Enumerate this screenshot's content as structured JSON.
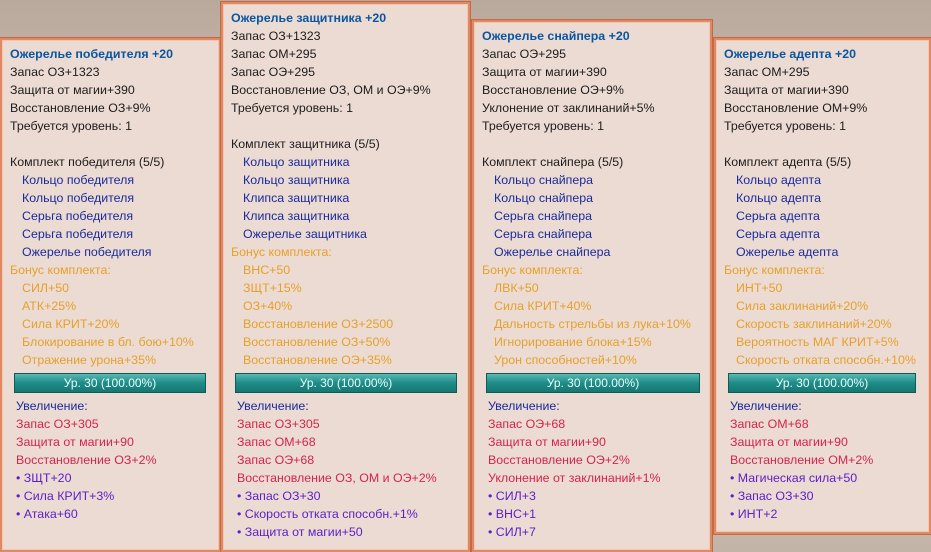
{
  "cards": [
    {
      "title": "Ожерелье победителя +20",
      "stats": [
        "Запас ОЗ+1323",
        "Защита от магии+390",
        "Восстановление ОЗ+9%",
        "Требуется уровень: 1"
      ],
      "set_name": "Комплект победителя (5/5)",
      "set_items": [
        "Кольцо победителя",
        "Кольцо победителя",
        "Серьга победителя",
        "Серьга победителя",
        "Ожерелье победителя"
      ],
      "bonus_header": "Бонус комплекта:",
      "bonuses": [
        "СИЛ+50",
        "АТК+25%",
        "Сила КРИТ+20%",
        "Блокирование в бл. бою+10%",
        "Отражение урона+35%"
      ],
      "level_bar": "Ур. 30 (100.00%)",
      "increase_header": "Увеличение:",
      "increases": [
        "Запас ОЗ+305",
        "Защита от магии+90",
        "Восстановление ОЗ+2%"
      ],
      "extras": [
        "• ЗЩТ+20",
        "• Сила КРИТ+3%",
        "• Атака+60"
      ]
    },
    {
      "title": "Ожерелье защитника +20",
      "stats": [
        "Запас ОЗ+1323",
        "Запас ОМ+295",
        "Запас ОЭ+295",
        "Восстановление ОЗ, ОМ и ОЭ+9%",
        "Требуется уровень: 1"
      ],
      "set_name": "Комплект защитника (5/5)",
      "set_items": [
        "Кольцо защитника",
        "Кольцо защитника",
        "Клипса защитника",
        "Клипса защитника",
        "Ожерелье защитника"
      ],
      "bonus_header": "Бонус комплекта:",
      "bonuses": [
        "ВНС+50",
        "ЗЩТ+15%",
        "ОЗ+40%",
        "Восстановление ОЗ+2500",
        "Восстановление ОЗ+50%",
        "Восстановление ОЭ+35%"
      ],
      "level_bar": "Ур. 30 (100.00%)",
      "increase_header": "Увеличение:",
      "increases": [
        "Запас ОЗ+305",
        "Запас ОМ+68",
        "Запас ОЭ+68",
        "Восстановление ОЗ, ОМ и ОЭ+2%"
      ],
      "extras": [
        "• Запас ОЗ+30",
        "• Скорость отката способн.+1%",
        "• Защита от магии+50"
      ]
    },
    {
      "title": "Ожерелье снайпера +20",
      "stats": [
        "Запас ОЭ+295",
        "Защита от магии+390",
        "Восстановление ОЭ+9%",
        "Уклонение от заклинаний+5%",
        "Требуется уровень: 1"
      ],
      "set_name": "Комплект снайпера (5/5)",
      "set_items": [
        "Кольцо снайпера",
        "Кольцо снайпера",
        "Серьга снайпера",
        "Серьга снайпера",
        "Ожерелье снайпера"
      ],
      "bonus_header": "Бонус комплекта:",
      "bonuses": [
        "ЛВК+50",
        "Сила КРИТ+40%",
        "Дальность стрельбы из лука+10%",
        "Игнорирование блока+15%",
        "Урон способностей+10%"
      ],
      "level_bar": "Ур. 30 (100.00%)",
      "increase_header": "Увеличение:",
      "increases": [
        "Запас ОЭ+68",
        "Защита от магии+90",
        "Восстановление ОЭ+2%",
        "Уклонение от заклинаний+1%"
      ],
      "extras": [
        "• СИЛ+3",
        "• ВНС+1",
        "• СИЛ+7"
      ]
    },
    {
      "title": "Ожерелье адепта +20",
      "stats": [
        "Запас ОМ+295",
        "Защита от магии+390",
        "Восстановление ОМ+9%",
        "Требуется уровень: 1"
      ],
      "set_name": "Комплект адепта (5/5)",
      "set_items": [
        "Кольцо адепта",
        "Кольцо адепта",
        "Серьга адепта",
        "Серьга адепта",
        "Ожерелье адепта"
      ],
      "bonus_header": "Бонус комплекта:",
      "bonuses": [
        "ИНТ+50",
        "Сила заклинаний+20%",
        "Скорость заклинаний+20%",
        "Вероятность МАГ КРИТ+5%",
        "Скорость отката способн.+10%"
      ],
      "level_bar": "Ур. 30 (100.00%)",
      "increase_header": "Увеличение:",
      "increases": [
        "Запас ОМ+68",
        "Защита от магии+90",
        "Восстановление ОМ+2%"
      ],
      "extras": [
        "• Магическая сила+50",
        "• Запас ОЗ+30",
        "• ИНТ+2"
      ]
    }
  ]
}
